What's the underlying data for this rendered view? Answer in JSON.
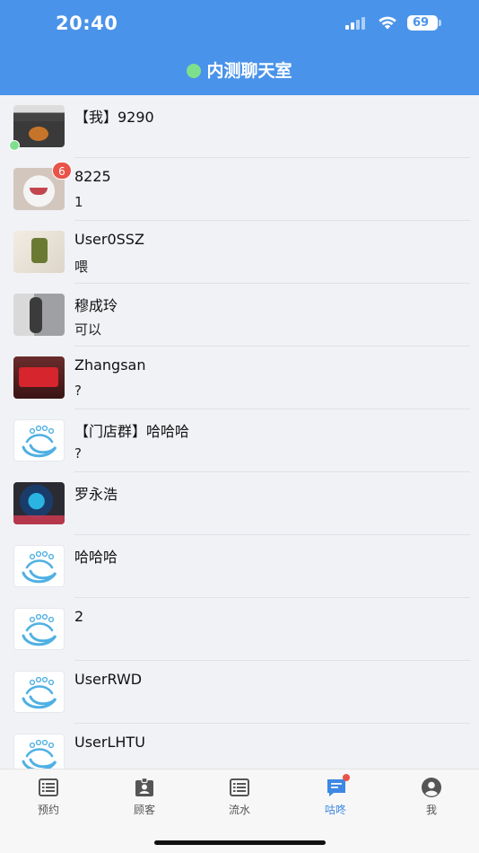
{
  "status_bar": {
    "time": "20:40",
    "battery": "69"
  },
  "header": {
    "title": "内测聊天室"
  },
  "chats": [
    {
      "name": "【我】9290",
      "message": "",
      "avatar": "photo1",
      "badge": "",
      "online": true
    },
    {
      "name": "8225",
      "message": "1",
      "avatar": "photo2",
      "badge": "6",
      "online": false
    },
    {
      "name": "User0SSZ",
      "message": "喂",
      "avatar": "photo3",
      "badge": "",
      "online": false
    },
    {
      "name": "穆成玲",
      "message": "可以",
      "avatar": "photo4",
      "badge": "",
      "online": false
    },
    {
      "name": "Zhangsan",
      "message": "?",
      "avatar": "photo5",
      "badge": "",
      "online": false
    },
    {
      "name": "【门店群】哈哈哈",
      "message": "?",
      "avatar": "default",
      "badge": "",
      "online": false
    },
    {
      "name": "罗永浩",
      "message": "",
      "avatar": "photo6",
      "badge": "",
      "online": false
    },
    {
      "name": "哈哈哈",
      "message": "",
      "avatar": "default",
      "badge": "",
      "online": false
    },
    {
      "name": "2",
      "message": "",
      "avatar": "default",
      "badge": "",
      "online": false
    },
    {
      "name": "UserRWD",
      "message": "",
      "avatar": "default",
      "badge": "",
      "online": false
    },
    {
      "name": "UserLHTU",
      "message": "",
      "avatar": "default",
      "badge": "",
      "online": false
    }
  ],
  "tabs": [
    {
      "label": "预约",
      "icon": "list-icon",
      "active": false
    },
    {
      "label": "顾客",
      "icon": "badge-icon",
      "active": false
    },
    {
      "label": "流水",
      "icon": "ledger-icon",
      "active": false
    },
    {
      "label": "咕咚",
      "icon": "chat-icon",
      "active": true
    },
    {
      "label": "我",
      "icon": "profile-icon",
      "active": false
    }
  ],
  "colors": {
    "primary": "#4a93ea",
    "active_tab": "#3d88e4",
    "badge": "#e8534a",
    "online": "#7ee08d"
  }
}
